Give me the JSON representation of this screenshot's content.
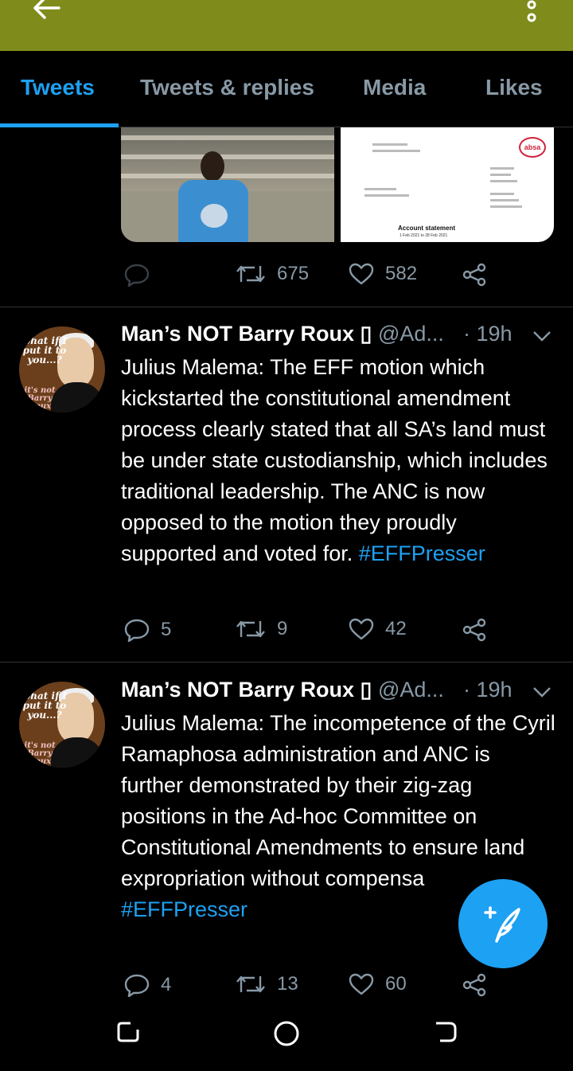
{
  "tabs": [
    {
      "label": "Tweets",
      "active": true
    },
    {
      "label": "Tweets & replies",
      "active": false
    },
    {
      "label": "Media",
      "active": false
    },
    {
      "label": "Likes",
      "active": false
    }
  ],
  "media_doc": {
    "logo": "absa",
    "title": "Account statement",
    "subtitle": "1 Feb 2021 to 28 Feb 2021"
  },
  "first_actions": {
    "reply": "",
    "retweets": "675",
    "likes": "582"
  },
  "tweets": [
    {
      "name": "Man’s NOT Barry Roux ▯",
      "handle": "@Ad...",
      "time": "· 19h",
      "text": "Julius Malema: The EFF motion which kickstarted the constitutional amendment process clearly stated that all SA’s land must be under state custodianship, which includes traditional leadership. The ANC is now opposed to the motion they proudly supported and voted for. ",
      "hashtag": "#EFFPresser",
      "replies": "5",
      "retweets": "9",
      "likes": "42",
      "avatar_caption": "what if I put it to you...?",
      "avatar_caption2": "it's not Barry Roux"
    },
    {
      "name": "Man’s NOT Barry Roux ▯",
      "handle": "@Ad...",
      "time": "· 19h",
      "text": "Julius Malema: The incompetence of the Cyril Ramaphosa administration and ANC is further demonstrated by their zig-zag positions in the Ad-hoc Committee on Constitutional Amendments to ensure land expropriation without compensa",
      "hashtag": "#EFFPresser",
      "replies": "4",
      "retweets": "13",
      "likes": "60",
      "avatar_caption": "what if I put it to you...?",
      "avatar_caption2": "it's not Barry Roux"
    }
  ],
  "colors": {
    "accent": "#1da1f2",
    "topbar": "#7f8c1c",
    "muted": "#8899a6"
  }
}
